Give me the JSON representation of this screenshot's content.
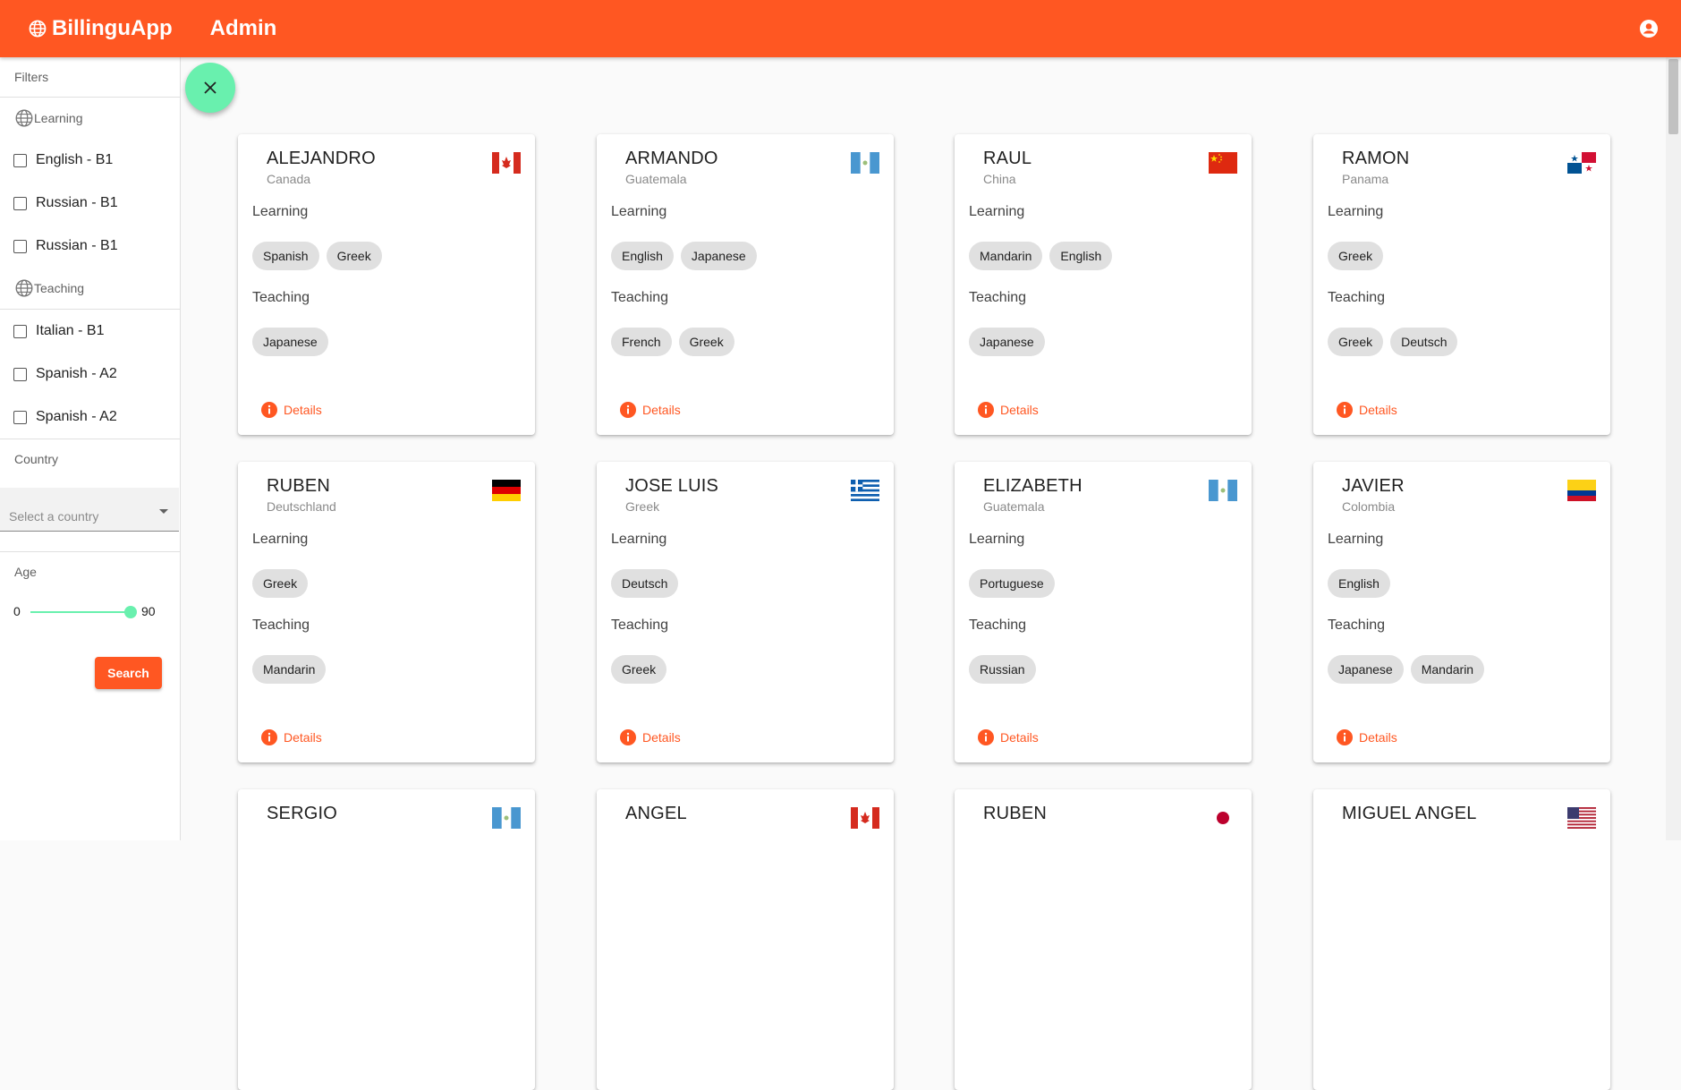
{
  "app": {
    "brand": "BillinguApp",
    "section": "Admin"
  },
  "sidebar": {
    "filters_heading": "Filters",
    "learning_heading": "Learning",
    "learning_items": [
      {
        "label": "English - B1"
      },
      {
        "label": "Russian - B1"
      },
      {
        "label": "Russian - B1"
      }
    ],
    "teaching_heading": "Teaching",
    "teaching_items": [
      {
        "label": "Italian - B1"
      },
      {
        "label": "Spanish - A2"
      },
      {
        "label": "Spanish - A2"
      }
    ],
    "country_heading": "Country",
    "country_placeholder": "Select a country",
    "age_heading": "Age",
    "age_min": "0",
    "age_max": "90",
    "search_label": "Search"
  },
  "cards": [
    {
      "name": "ALEJANDRO",
      "country": "Canada",
      "flag": "canada",
      "learning_label": "Learning",
      "learning": [
        "Spanish",
        "Greek"
      ],
      "teaching_label": "Teaching",
      "teaching": [
        "Japanese"
      ],
      "details": "Details"
    },
    {
      "name": "ARMANDO",
      "country": "Guatemala",
      "flag": "guatemala",
      "learning_label": "Learning",
      "learning": [
        "English",
        "Japanese"
      ],
      "teaching_label": "Teaching",
      "teaching": [
        "French",
        "Greek"
      ],
      "details": "Details"
    },
    {
      "name": "RAUL",
      "country": "China",
      "flag": "china",
      "learning_label": "Learning",
      "learning": [
        "Mandarin",
        "English"
      ],
      "teaching_label": "Teaching",
      "teaching": [
        "Japanese"
      ],
      "details": "Details"
    },
    {
      "name": "RAMON",
      "country": "Panama",
      "flag": "panama",
      "learning_label": "Learning",
      "learning": [
        "Greek"
      ],
      "teaching_label": "Teaching",
      "teaching": [
        "Greek",
        "Deutsch"
      ],
      "details": "Details"
    },
    {
      "name": "RUBEN",
      "country": "Deutschland",
      "flag": "germany",
      "learning_label": "Learning",
      "learning": [
        "Greek"
      ],
      "teaching_label": "Teaching",
      "teaching": [
        "Mandarin"
      ],
      "details": "Details"
    },
    {
      "name": "JOSE LUIS",
      "country": "Greek",
      "flag": "greece",
      "learning_label": "Learning",
      "learning": [
        "Deutsch"
      ],
      "teaching_label": "Teaching",
      "teaching": [
        "Greek"
      ],
      "details": "Details"
    },
    {
      "name": "ELIZABETH",
      "country": "Guatemala",
      "flag": "guatemala",
      "learning_label": "Learning",
      "learning": [
        "Portuguese"
      ],
      "teaching_label": "Teaching",
      "teaching": [
        "Russian"
      ],
      "details": "Details"
    },
    {
      "name": "JAVIER",
      "country": "Colombia",
      "flag": "colombia",
      "learning_label": "Learning",
      "learning": [
        "English"
      ],
      "teaching_label": "Teaching",
      "teaching": [
        "Japanese",
        "Mandarin"
      ],
      "details": "Details"
    },
    {
      "name": "SERGIO",
      "country": "",
      "flag": "guatemala",
      "learning_label": "",
      "learning": [],
      "teaching_label": "",
      "teaching": [],
      "details": ""
    },
    {
      "name": "ANGEL",
      "country": "",
      "flag": "canada",
      "learning_label": "",
      "learning": [],
      "teaching_label": "",
      "teaching": [],
      "details": ""
    },
    {
      "name": "RUBEN",
      "country": "",
      "flag": "japan",
      "learning_label": "",
      "learning": [],
      "teaching_label": "",
      "teaching": [],
      "details": ""
    },
    {
      "name": "MIGUEL ANGEL",
      "country": "",
      "flag": "usa",
      "learning_label": "",
      "learning": [],
      "teaching_label": "",
      "teaching": [],
      "details": ""
    }
  ],
  "colors": {
    "primary": "#ff5722",
    "accent": "#69f0ae"
  },
  "icons": {
    "brand": "globe-icon",
    "account": "account-circle-icon",
    "fab": "close-icon",
    "details": "info-icon"
  }
}
